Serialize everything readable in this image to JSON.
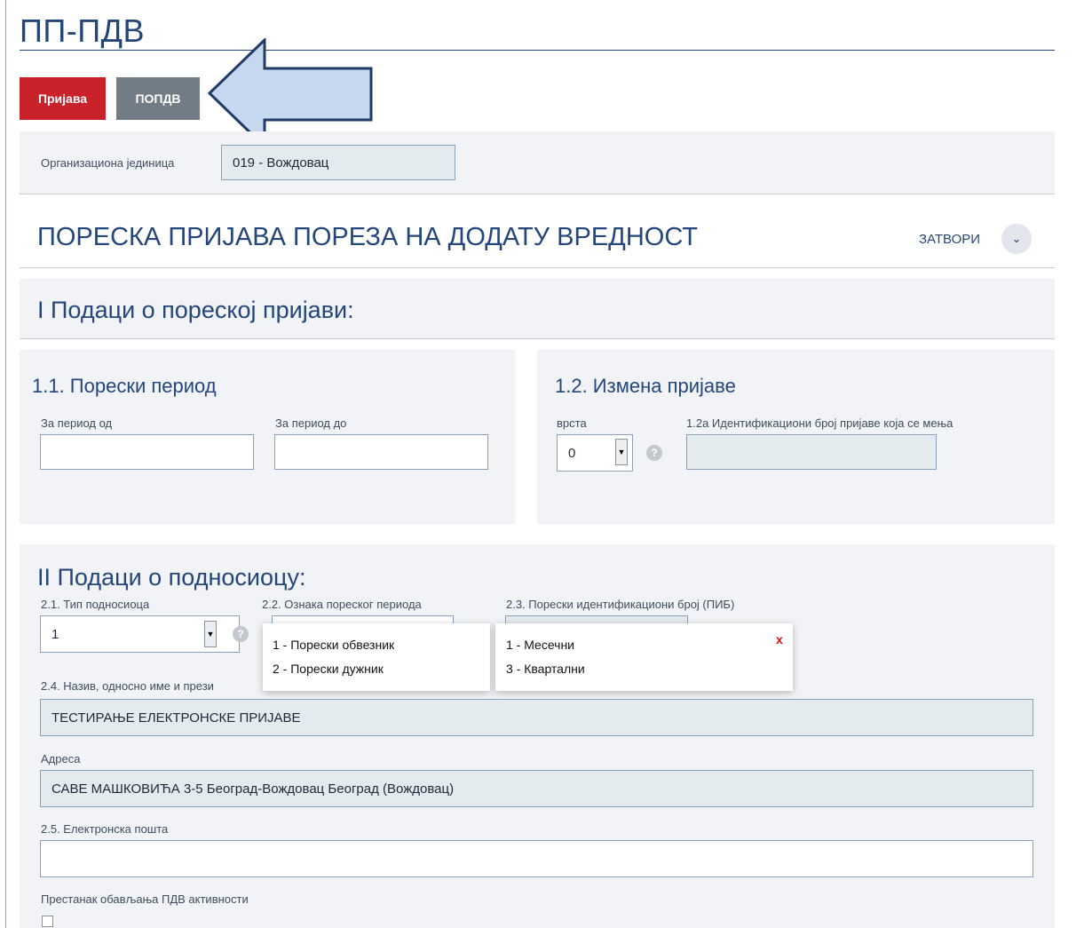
{
  "header": {
    "title": "ПП-ПДВ"
  },
  "tabs": [
    {
      "label": "Пријава"
    },
    {
      "label": "ПОПДВ"
    }
  ],
  "org_unit": {
    "label": "Организациона јединица",
    "value": "019 - Вождовац"
  },
  "form_header": {
    "title": "ПОРЕСКА ПРИЈАВА ПОРЕЗА НА ДОДАТУ ВРЕДНОСТ",
    "close_label": "ЗАТВОРИ"
  },
  "section1": {
    "title": "I Подаци о пореској пријави:",
    "period": {
      "title": "1.1. Порески период",
      "from_label": "За период од",
      "from_value": "",
      "to_label": "За период до",
      "to_value": ""
    },
    "change": {
      "title": "1.2. Измена пријаве",
      "type_label": "врста",
      "type_value": "0",
      "id_label": "1.2а Идентификациони број пријаве која се мења",
      "id_value": ""
    }
  },
  "section2": {
    "title": "II Подаци о подносиоцу:",
    "submitter_type_label": "2.1. Тип подносиоца",
    "submitter_type_value": "1",
    "period_mark_label": "2.2. Ознака пореског периода",
    "pib_label": "2.3. Порески идентификациони број (ПИБ)",
    "name_label": "2.4. Назив, односно име и прези",
    "name_value": "ТЕСТИРАЊЕ ЕЛЕКТРОНСКЕ ПРИЈАВЕ",
    "address_label": "Адреса",
    "address_value": "САВЕ МАШКОВИЋА 3-5 Београд-Вождовац Београд (Вождовац)",
    "email_label": "2.5. Електронска пошта",
    "email_value": "",
    "cease_label": "Престанак обављања ПДВ активности"
  },
  "dropdown_type": {
    "options": [
      "1 - Порески обвезник",
      "2 - Порески дужник"
    ]
  },
  "dropdown_period": {
    "options": [
      "1 - Месечни",
      "3 - Квартални"
    ],
    "close": "x"
  },
  "icons": {
    "help": "?",
    "chevron": "chevron-down-icon"
  },
  "colors": {
    "accent_red": "#c9222a",
    "accent_grey": "#727c86",
    "heading_blue": "#24467a",
    "arrow_fill": "#c6d8ef"
  }
}
